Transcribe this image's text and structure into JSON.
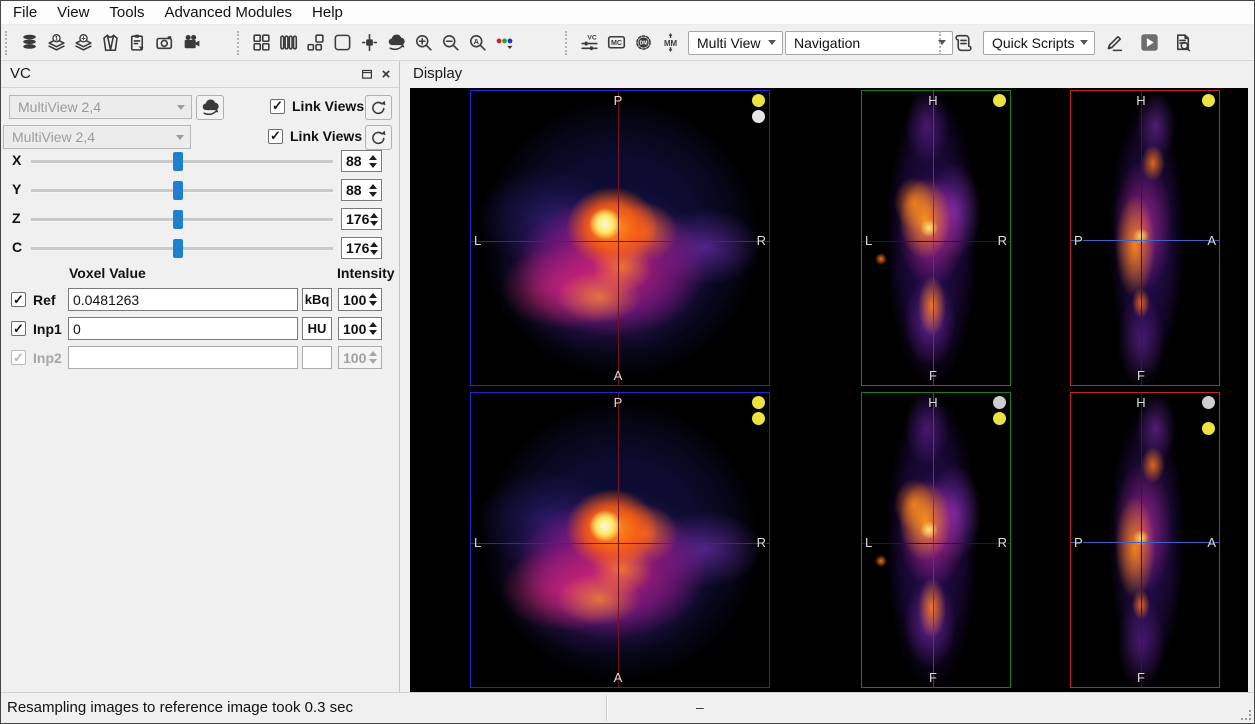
{
  "menu": {
    "items": [
      "File",
      "View",
      "Tools",
      "Advanced Modules",
      "Help"
    ]
  },
  "toolbar": {
    "group1_icons": [
      "database",
      "layers-current",
      "layers-add",
      "body-volume",
      "clipboard-report",
      "camera-capture",
      "cine-capture"
    ],
    "group2_icons": [
      "layout-grid",
      "layout-columns",
      "layout-mixed",
      "layout-single",
      "pin-crosshair",
      "view-reset-camera",
      "zoom-in",
      "zoom-out",
      "zoom-auto",
      "color-channels"
    ],
    "group3_icons": [
      "vc-controls",
      "mc-controls",
      "dm-settings",
      "mm-scaling"
    ],
    "multi_view": "Multi View",
    "navigation": "Navigation",
    "group4_icons": [
      "quick-scripts-scroll",
      "edit-script-pencil",
      "run-script-play",
      "script-log-document"
    ],
    "quick_scripts": "Quick Scripts"
  },
  "vc_panel": {
    "title": "VC",
    "dropdown1": "MultiView 2,4",
    "dropdown2": "MultiView 2,4",
    "link_views1": "Link Views",
    "link_views2": "Link Views",
    "sliders": [
      {
        "label": "X",
        "value": "88"
      },
      {
        "label": "Y",
        "value": "88"
      },
      {
        "label": "Z",
        "value": "176"
      },
      {
        "label": "C",
        "value": "176"
      }
    ],
    "voxel": {
      "value_header": "Voxel Value",
      "intensity_header": "Intensity",
      "rows": [
        {
          "label": "Ref",
          "value": "0.0481263",
          "unit": "kBq",
          "intensity": "100",
          "checked": true,
          "enabled": true
        },
        {
          "label": "Inp1",
          "value": "0",
          "unit": "HU",
          "intensity": "100",
          "checked": true,
          "enabled": true
        },
        {
          "label": "Inp2",
          "value": "",
          "unit": "",
          "intensity": "100",
          "checked": true,
          "enabled": false
        }
      ]
    }
  },
  "display": {
    "title": "Display",
    "views": [
      {
        "type": "axial",
        "border_color": "#2525d8",
        "labels": {
          "top": "P",
          "bottom": "A",
          "left": "L",
          "right": "R"
        },
        "dots": [
          "yellow",
          "white"
        ]
      },
      {
        "type": "coronal",
        "border_color": "#1d7a1d",
        "labels": {
          "top": "H",
          "bottom": "F",
          "left": "L",
          "right": "R"
        },
        "dots": [
          "yellow"
        ]
      },
      {
        "type": "sagittal",
        "border_color": "#c42222",
        "labels": {
          "top": "H",
          "bottom": "F",
          "left": "P",
          "right": "A"
        },
        "dots": [
          "yellow"
        ]
      },
      {
        "type": "axial",
        "border_color": "#2525d8",
        "labels": {
          "top": "P",
          "bottom": "A",
          "left": "L",
          "right": "R"
        },
        "dots": [
          "yellow",
          "yellow"
        ]
      },
      {
        "type": "coronal",
        "border_color": "#1d7a1d",
        "labels": {
          "top": "H",
          "bottom": "F",
          "left": "L",
          "right": "R"
        },
        "dots": [
          "grey",
          "yellow"
        ]
      },
      {
        "type": "sagittal",
        "border_color": "#c42222",
        "labels": {
          "top": "H",
          "bottom": "F",
          "left": "P",
          "right": "A"
        },
        "dots": [
          "grey",
          "gap",
          "yellow"
        ]
      }
    ]
  },
  "status": {
    "message": "Resampling images to reference image took 0.3 sec",
    "placeholder": "–"
  }
}
